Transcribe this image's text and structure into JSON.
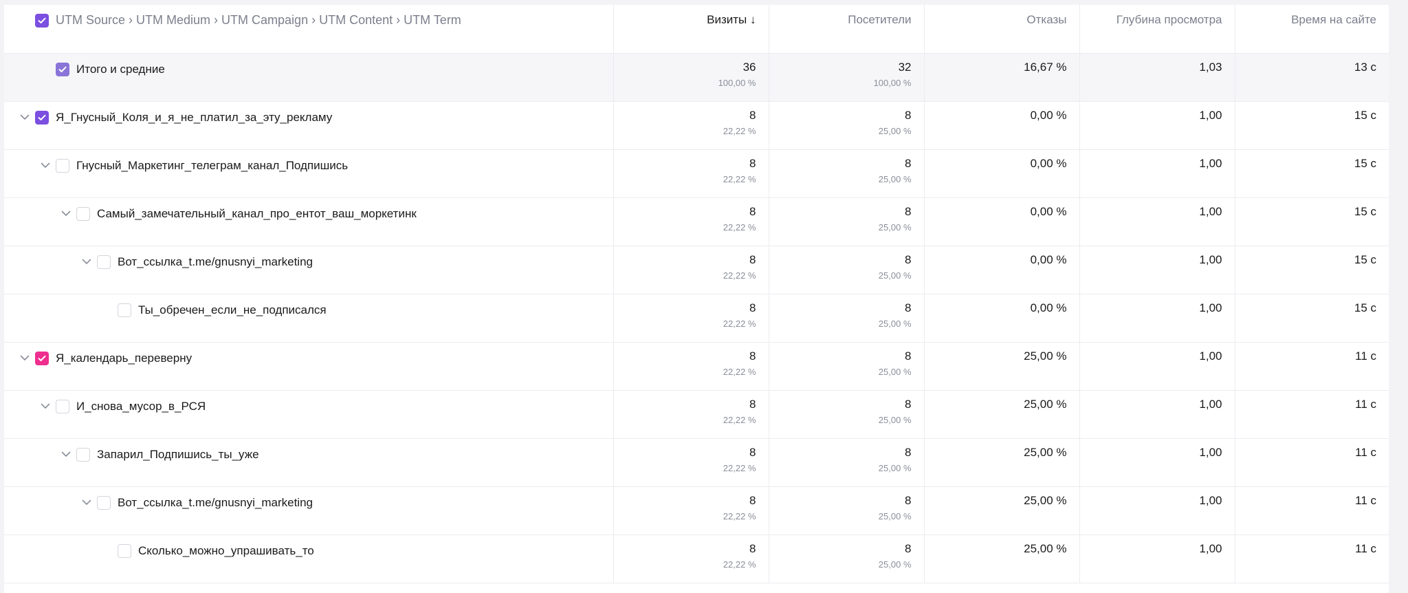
{
  "header": {
    "dimensions": [
      "UTM Source",
      "UTM Medium",
      "UTM Campaign",
      "UTM Content",
      "UTM Term"
    ],
    "separator": "›",
    "columns": {
      "visits": "Визиты",
      "sort_indicator": "↓",
      "users": "Посетители",
      "bounce": "Отказы",
      "depth": "Глубина просмотра",
      "time": "Время на сайте"
    }
  },
  "colors": {
    "purple": "#7b4fe0",
    "pink": "#ee2f8f",
    "total_checkbox": "#8a74d8"
  },
  "rows": [
    {
      "label": "Итого и средние",
      "level": 0,
      "total": true,
      "expandable": false,
      "checked": true,
      "check_color": "total_checkbox",
      "visits": "36",
      "visits_share": "100,00 %",
      "users": "32",
      "users_share": "100,00 %",
      "bounce": "16,67 %",
      "depth": "1,03",
      "time": "13 с"
    },
    {
      "label": "Я_Гнусный_Коля_и_я_не_платил_за_эту_рекламу",
      "level": 0,
      "expandable": true,
      "checked": true,
      "check_color": "purple",
      "visits": "8",
      "visits_share": "22,22 %",
      "users": "8",
      "users_share": "25,00 %",
      "bounce": "0,00 %",
      "depth": "1,00",
      "time": "15 с"
    },
    {
      "label": "Гнусный_Маркетинг_телеграм_канал_Подпишись",
      "level": 1,
      "expandable": true,
      "checked": false,
      "visits": "8",
      "visits_share": "22,22 %",
      "users": "8",
      "users_share": "25,00 %",
      "bounce": "0,00 %",
      "depth": "1,00",
      "time": "15 с"
    },
    {
      "label": "Самый_замечательный_канал_про_ентот_ваш_моркетинк",
      "level": 2,
      "expandable": true,
      "checked": false,
      "visits": "8",
      "visits_share": "22,22 %",
      "users": "8",
      "users_share": "25,00 %",
      "bounce": "0,00 %",
      "depth": "1,00",
      "time": "15 с"
    },
    {
      "label": "Вот_ссылка_t.me/gnusnyi_marketing",
      "level": 3,
      "expandable": true,
      "checked": false,
      "visits": "8",
      "visits_share": "22,22 %",
      "users": "8",
      "users_share": "25,00 %",
      "bounce": "0,00 %",
      "depth": "1,00",
      "time": "15 с"
    },
    {
      "label": "Ты_обречен_если_не_подписался",
      "level": 4,
      "expandable": false,
      "checked": false,
      "visits": "8",
      "visits_share": "22,22 %",
      "users": "8",
      "users_share": "25,00 %",
      "bounce": "0,00 %",
      "depth": "1,00",
      "time": "15 с"
    },
    {
      "label": "Я_календарь_переверну",
      "level": 0,
      "expandable": true,
      "checked": true,
      "check_color": "pink",
      "visits": "8",
      "visits_share": "22,22 %",
      "users": "8",
      "users_share": "25,00 %",
      "bounce": "25,00 %",
      "depth": "1,00",
      "time": "11 с"
    },
    {
      "label": "И_снова_мусор_в_РСЯ",
      "level": 1,
      "expandable": true,
      "checked": false,
      "visits": "8",
      "visits_share": "22,22 %",
      "users": "8",
      "users_share": "25,00 %",
      "bounce": "25,00 %",
      "depth": "1,00",
      "time": "11 с"
    },
    {
      "label": "Запарил_Подпишись_ты_уже",
      "level": 2,
      "expandable": true,
      "checked": false,
      "visits": "8",
      "visits_share": "22,22 %",
      "users": "8",
      "users_share": "25,00 %",
      "bounce": "25,00 %",
      "depth": "1,00",
      "time": "11 с"
    },
    {
      "label": "Вот_ссылка_t.me/gnusnyi_marketing",
      "level": 3,
      "expandable": true,
      "checked": false,
      "visits": "8",
      "visits_share": "22,22 %",
      "users": "8",
      "users_share": "25,00 %",
      "bounce": "25,00 %",
      "depth": "1,00",
      "time": "11 с"
    },
    {
      "label": "Сколько_можно_упрашивать_то",
      "level": 4,
      "expandable": false,
      "checked": false,
      "visits": "8",
      "visits_share": "22,22 %",
      "users": "8",
      "users_share": "25,00 %",
      "bounce": "25,00 %",
      "depth": "1,00",
      "time": "11 с"
    }
  ]
}
